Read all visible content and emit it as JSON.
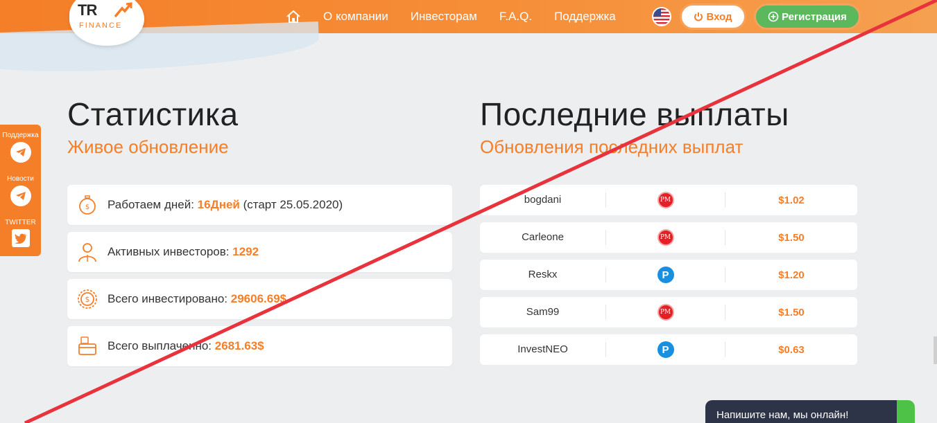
{
  "colors": {
    "accent": "#f57e28",
    "green": "#5cb85c",
    "cross": "#e8323c"
  },
  "logo": {
    "tr": "TR",
    "sub": "FINANCE"
  },
  "nav": {
    "items": [
      "О компании",
      "Инвесторам",
      "F.A.Q.",
      "Поддержка"
    ],
    "login": "Вход",
    "register": "Регистрация"
  },
  "side": {
    "support": "Поддержка",
    "news": "Новости",
    "twitter": "TWITTER"
  },
  "stats": {
    "title": "Статистика",
    "subtitle": "Живое обновление",
    "days": {
      "label": "Работаем дней: ",
      "value": "16Дней",
      "suffix": " (старт 25.05.2020)"
    },
    "investors": {
      "label": "Активных инвесторов: ",
      "value": "1292"
    },
    "invested": {
      "label": "Всего инвестировано: ",
      "value": "29606.69$"
    },
    "paid": {
      "label": "Всего выплаченно: ",
      "value": "2681.63$"
    }
  },
  "payouts": {
    "title": "Последние выплаты",
    "subtitle": "Обновления последних выплат",
    "rows": [
      {
        "name": "bogdani",
        "system": "PM",
        "amount": "$1.02"
      },
      {
        "name": "Carleone",
        "system": "PM",
        "amount": "$1.50"
      },
      {
        "name": "Reskx",
        "system": "P",
        "amount": "$1.20"
      },
      {
        "name": "Sam99",
        "system": "PM",
        "amount": "$1.50"
      },
      {
        "name": "InvestNEO",
        "system": "P",
        "amount": "$0.63"
      }
    ]
  },
  "chat": {
    "text": "Напишите нам, мы онлайн!"
  }
}
